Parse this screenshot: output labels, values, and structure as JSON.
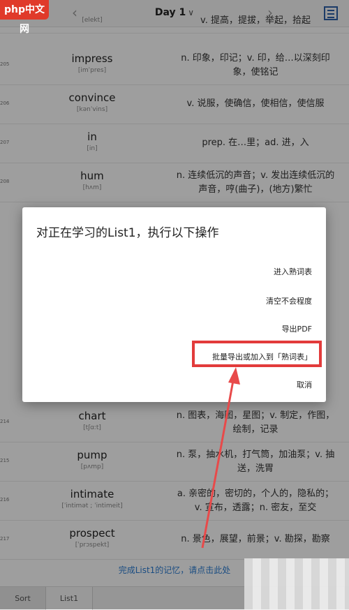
{
  "header": {
    "title": "Day 1",
    "prev_label": "‹",
    "next_label": "›"
  },
  "words": [
    {
      "index": "",
      "word": "",
      "phonetic": "[elekt]",
      "meaning": "v. 提高，提拔，举起，拾起",
      "single": true
    },
    {
      "index": "205",
      "word": "impress",
      "phonetic": "[imˈpres]",
      "meaning": "n. 印象，印记；v. 印，给…以深刻印象，使铭记",
      "single": false
    },
    {
      "index": "206",
      "word": "convince",
      "phonetic": "[kənˈvins]",
      "meaning": "v. 说服，使确信，使相信，使信服",
      "single": true
    },
    {
      "index": "207",
      "word": "in",
      "phonetic": "[in]",
      "meaning": "prep. 在…里；ad. 进，入",
      "single": true
    },
    {
      "index": "208",
      "word": "hum",
      "phonetic": "[hʌm]",
      "meaning": "n. 连续低沉的声音；v. 发出连续低沉的声音，哼(曲子)，(地方)繁忙",
      "single": false
    },
    {
      "index": "214",
      "word": "chart",
      "phonetic": "[tʃɑːt]",
      "meaning": "n. 图表，海图，星图；v. 制定，作图，绘制，记录",
      "single": false
    },
    {
      "index": "215",
      "word": "pump",
      "phonetic": "[pʌmp]",
      "meaning": "n. 泵，抽水机，打气筒，加油泵；v. 抽送，洗胃",
      "single": false
    },
    {
      "index": "216",
      "word": "intimate",
      "phonetic": "[ˈintimət ; ˈintimeit]",
      "meaning": "a. 亲密的，密切的，个人的，隐私的；v. 宣布，透露；n. 密友，至交",
      "single": false
    },
    {
      "index": "217",
      "word": "prospect",
      "phonetic": "[ˈprɔspekt]",
      "meaning": "n. 景色，展望，前景；v. 勘探，勘察",
      "single": true
    }
  ],
  "footer_message": "完成List1的记忆，请点击此处",
  "bottom_tabs": {
    "sort": "Sort",
    "list": "List1"
  },
  "dialog": {
    "title": "对正在学习的List1，执行以下操作",
    "options": [
      "进入熟词表",
      "清空不会程度",
      "导出PDF",
      "批量导出或加入到「熟词表」",
      "取消"
    ]
  },
  "watermark": "php中文网",
  "colors": {
    "accent": "#2d5fa8",
    "highlight": "#e23b3b",
    "link": "#2d7dd2"
  }
}
